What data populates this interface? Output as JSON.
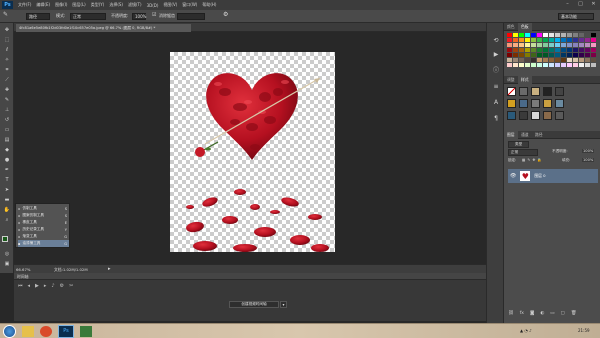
{
  "app": {
    "logo": "Ps"
  },
  "menu": [
    "文件(F)",
    "编辑(E)",
    "图像(I)",
    "图层(L)",
    "类型(Y)",
    "选择(S)",
    "滤镜(T)",
    "3D(D)",
    "视图(V)",
    "窗口(W)",
    "帮助(H)"
  ],
  "options": {
    "shape_value": "路径",
    "mode_label": "模式:",
    "mode_value": "正常",
    "opacity_label": "不透明度:",
    "opacity_value": "100%",
    "smooth_label": "消除锯齿",
    "workspace_value": "基本功能"
  },
  "document": {
    "tab_title": "4fc81a6e5e80fb1f2d03fd0e1f10c657e05a.jpeg @ 66.7% (图层 0, RGB/8#) *",
    "zoom": "66.67%",
    "doc_info": "文档:1.02M/1.02M"
  },
  "tool_flyout": [
    {
      "label": "仿制工具",
      "key": "S"
    },
    {
      "label": "图案仿制工具",
      "key": "S"
    },
    {
      "label": "橡皮工具",
      "key": "E"
    },
    {
      "label": "历史记录工具",
      "key": "Y"
    },
    {
      "label": "渐变工具",
      "key": "G"
    },
    {
      "label": "油漆桶工具",
      "key": "G"
    }
  ],
  "timeline": {
    "title": "时间轴",
    "create_button": "创建视频时间轴"
  },
  "panels": {
    "top_tabs": [
      "颜色",
      "色板"
    ],
    "style_tabs": [
      "调整",
      "样式"
    ],
    "layer_tabs": [
      "图层",
      "通道",
      "路径"
    ],
    "kind_label": "类型",
    "blend_value": "正常",
    "opacity_label": "不透明度:",
    "opacity_value": "100%",
    "lock_label": "锁定:",
    "fill_label": "填充:",
    "fill_value": "100%",
    "layer_name": "图层 0"
  },
  "taskbar": {
    "time": "21:59"
  },
  "colors": {
    "accent": "#5b7089",
    "rose": "#b51020"
  }
}
